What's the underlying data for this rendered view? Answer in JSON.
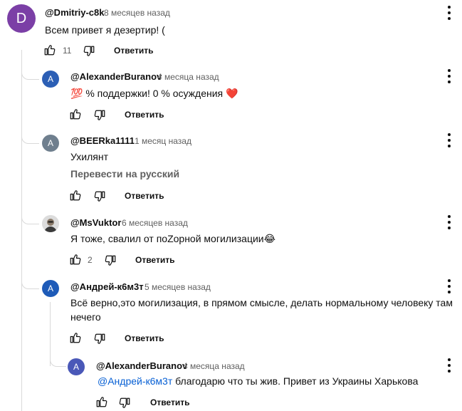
{
  "colors": {
    "avatar_top": "#7b3fa6",
    "avatar_blue": "#2c5fb5",
    "avatar_grey": "#6f7f8e",
    "avatar_navy": "#1e5bb8",
    "muted": "#606060",
    "link": "#065fd4"
  },
  "comment": {
    "avatar_letter": "D",
    "author": "@Dmitriy-c8k",
    "time": "8 месяцев назад",
    "text": "Всем привет я дезертир! (",
    "likes": "11",
    "reply_label": "Ответить"
  },
  "replies": [
    {
      "avatar_letter": "A",
      "author": "@AlexanderBuranov",
      "time": "4 месяца назад",
      "emoji": "💯",
      "text": " % поддержки! 0 % осуждения ",
      "heart": "❤️",
      "reply_label": "Ответить"
    },
    {
      "avatar_letter": "A",
      "author": "@BEERka1111",
      "time": "1 месяц назад",
      "text": "Ухилянт",
      "translate_label": "Перевести на русский",
      "reply_label": "Ответить"
    },
    {
      "avatar_letter": "",
      "author": "@MsVuktor",
      "time": "6 месяцев назад",
      "text": "Я тоже, свалил от поZорной могилизации",
      "emoji": "😂",
      "likes": "2",
      "reply_label": "Ответить"
    },
    {
      "avatar_letter": "A",
      "author": "@Андрей-к6м3т",
      "time": "5 месяцев назад",
      "text": "Всё верно,это могилизация, в прямом смысле, делать нормальному человеку там нечего",
      "reply_label": "Ответить"
    }
  ],
  "nested_reply": {
    "avatar_letter": "A",
    "author": "@AlexanderBuranov",
    "time": "4 месяца назад",
    "mention": "@Андрей-к6м3т",
    "text": " благодарю что ты жив.  Привет из Украины Харькова",
    "reply_label": "Ответить"
  }
}
